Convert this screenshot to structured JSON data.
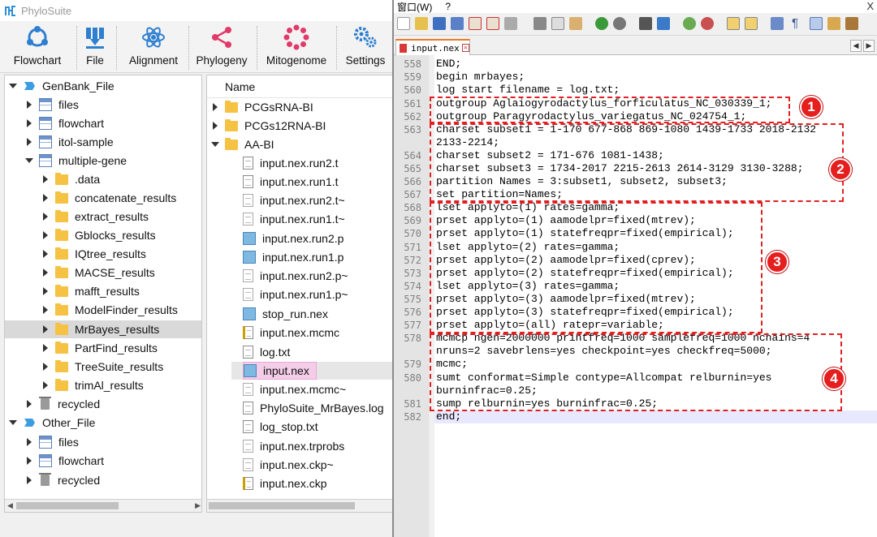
{
  "app": {
    "title": "PhyloSuite"
  },
  "toolbar": {
    "buttons": [
      {
        "label": "Flowchart",
        "icon": "flowchart-icon"
      },
      {
        "label": "File",
        "icon": "file-import-icon"
      },
      {
        "label": "Alignment",
        "icon": "atom-icon"
      },
      {
        "label": "Phylogeny",
        "icon": "tree-share-icon"
      },
      {
        "label": "Mitogenome",
        "icon": "mitogenome-ring-icon"
      },
      {
        "label": "Settings",
        "icon": "gears-icon"
      }
    ]
  },
  "tree": [
    {
      "label": "GenBank_File",
      "level": 0,
      "expanded": true,
      "icon": "genbank-icon"
    },
    {
      "label": "files",
      "level": 1,
      "expanded": false,
      "icon": "table-icon"
    },
    {
      "label": "flowchart",
      "level": 1,
      "expanded": false,
      "icon": "table-icon"
    },
    {
      "label": "itol-sample",
      "level": 1,
      "expanded": false,
      "icon": "table-icon"
    },
    {
      "label": "multiple-gene",
      "level": 1,
      "expanded": true,
      "icon": "table-icon"
    },
    {
      "label": ".data",
      "level": 2,
      "expanded": false,
      "icon": "folder-icon"
    },
    {
      "label": "concatenate_results",
      "level": 2,
      "expanded": false,
      "icon": "folder-icon"
    },
    {
      "label": "extract_results",
      "level": 2,
      "expanded": false,
      "icon": "folder-icon"
    },
    {
      "label": "Gblocks_results",
      "level": 2,
      "expanded": false,
      "icon": "folder-icon"
    },
    {
      "label": "IQtree_results",
      "level": 2,
      "expanded": false,
      "icon": "folder-icon"
    },
    {
      "label": "MACSE_results",
      "level": 2,
      "expanded": false,
      "icon": "folder-icon"
    },
    {
      "label": "mafft_results",
      "level": 2,
      "expanded": false,
      "icon": "folder-icon"
    },
    {
      "label": "ModelFinder_results",
      "level": 2,
      "expanded": false,
      "icon": "folder-icon"
    },
    {
      "label": "MrBayes_results",
      "level": 2,
      "expanded": false,
      "icon": "folder-icon",
      "selected": true
    },
    {
      "label": "PartFind_results",
      "level": 2,
      "expanded": false,
      "icon": "folder-icon"
    },
    {
      "label": "TreeSuite_results",
      "level": 2,
      "expanded": false,
      "icon": "folder-icon"
    },
    {
      "label": "trimAl_results",
      "level": 2,
      "expanded": false,
      "icon": "folder-icon"
    },
    {
      "label": "recycled",
      "level": 1,
      "expanded": false,
      "icon": "trash-icon"
    },
    {
      "label": "Other_File",
      "level": 0,
      "expanded": true,
      "icon": "genbank-icon"
    },
    {
      "label": "files",
      "level": 1,
      "expanded": false,
      "icon": "table-icon"
    },
    {
      "label": "flowchart",
      "level": 1,
      "expanded": false,
      "icon": "table-icon"
    },
    {
      "label": "recycled",
      "level": 1,
      "expanded": false,
      "icon": "trash-icon"
    }
  ],
  "file_list": {
    "header": "Name",
    "items": [
      {
        "label": "PCGsRNA-BI",
        "type": "folder",
        "level": 0
      },
      {
        "label": "PCGs12RNA-BI",
        "type": "folder",
        "level": 0
      },
      {
        "label": "AA-BI",
        "type": "folder",
        "level": 0,
        "expanded": true
      },
      {
        "label": "input.nex.run2.t",
        "type": "text",
        "level": 1
      },
      {
        "label": "input.nex.run1.t",
        "type": "text",
        "level": 1
      },
      {
        "label": "input.nex.run2.t~",
        "type": "blank",
        "level": 1
      },
      {
        "label": "input.nex.run1.t~",
        "type": "blank",
        "level": 1
      },
      {
        "label": "input.nex.run2.p",
        "type": "notepad",
        "level": 1
      },
      {
        "label": "input.nex.run1.p",
        "type": "notepad",
        "level": 1
      },
      {
        "label": "input.nex.run2.p~",
        "type": "blank",
        "level": 1
      },
      {
        "label": "input.nex.run1.p~",
        "type": "blank",
        "level": 1
      },
      {
        "label": "stop_run.nex",
        "type": "notepad",
        "level": 1
      },
      {
        "label": "input.nex.mcmc",
        "type": "edit",
        "level": 1
      },
      {
        "label": "log.txt",
        "type": "text",
        "level": 1
      },
      {
        "label": "input.nex",
        "type": "notepad",
        "level": 1,
        "selected": true
      },
      {
        "label": "input.nex.mcmc~",
        "type": "blank",
        "level": 1
      },
      {
        "label": "PhyloSuite_MrBayes.log",
        "type": "text",
        "level": 1
      },
      {
        "label": "log_stop.txt",
        "type": "text",
        "level": 1
      },
      {
        "label": "input.nex.trprobs",
        "type": "blank",
        "level": 1
      },
      {
        "label": "input.nex.ckp~",
        "type": "blank",
        "level": 1
      },
      {
        "label": "input.nex.ckp",
        "type": "edit",
        "level": 1
      }
    ]
  },
  "editor": {
    "menu": [
      "窗口(W)",
      "?"
    ],
    "close_glyph": "X",
    "tab_label": "input.nex",
    "lines": [
      {
        "no": "558",
        "text": "END;"
      },
      {
        "no": "559",
        "text": "begin mrbayes;"
      },
      {
        "no": "560",
        "text": "log start filename = log.txt;"
      },
      {
        "no": "561",
        "text": "outgroup Aglaiogyrodactylus_forficulatus_NC_030339_1;"
      },
      {
        "no": "562",
        "text": "outgroup Paragyrodactylus_variegatus_NC_024754_1;"
      },
      {
        "no": "563",
        "text": "charset subset1 = 1-170 677-868 869-1080 1439-1733 2018-2132"
      },
      {
        "no": "",
        "text": "2133-2214;"
      },
      {
        "no": "564",
        "text": "charset subset2 = 171-676 1081-1438;"
      },
      {
        "no": "565",
        "text": "charset subset3 = 1734-2017 2215-2613 2614-3129 3130-3288;"
      },
      {
        "no": "566",
        "text": "partition Names = 3:subset1, subset2, subset3;"
      },
      {
        "no": "567",
        "text": "set partition=Names;"
      },
      {
        "no": "568",
        "text": "lset applyto=(1) rates=gamma;"
      },
      {
        "no": "569",
        "text": "prset applyto=(1) aamodelpr=fixed(mtrev);"
      },
      {
        "no": "570",
        "text": "prset applyto=(1) statefreqpr=fixed(empirical);"
      },
      {
        "no": "571",
        "text": "lset applyto=(2) rates=gamma;"
      },
      {
        "no": "572",
        "text": "prset applyto=(2) aamodelpr=fixed(cprev);"
      },
      {
        "no": "573",
        "text": "prset applyto=(2) statefreqpr=fixed(empirical);"
      },
      {
        "no": "574",
        "text": "lset applyto=(3) rates=gamma;"
      },
      {
        "no": "575",
        "text": "prset applyto=(3) aamodelpr=fixed(mtrev);"
      },
      {
        "no": "576",
        "text": "prset applyto=(3) statefreqpr=fixed(empirical);"
      },
      {
        "no": "577",
        "text": "prset applyto=(all) ratepr=variable;"
      },
      {
        "no": "578",
        "text": "mcmcp ngen=2000000 printfreq=1000 samplefreq=1000 nchains=4"
      },
      {
        "no": "",
        "text": "nruns=2 savebrlens=yes checkpoint=yes checkfreq=5000;"
      },
      {
        "no": "579",
        "text": "mcmc;"
      },
      {
        "no": "580",
        "text": "sumt conformat=Simple contype=Allcompat relburnin=yes"
      },
      {
        "no": "",
        "text": "burninfrac=0.25;"
      },
      {
        "no": "581",
        "text": "sump relburnin=yes burninfrac=0.25;"
      },
      {
        "no": "582",
        "text": "end;"
      }
    ],
    "annotations": [
      "1",
      "2",
      "3",
      "4"
    ]
  },
  "colors": {
    "annotation_red": "#e51e1e",
    "selection_gray": "#d9d9d9",
    "tab_accent": "#e87b2a"
  }
}
